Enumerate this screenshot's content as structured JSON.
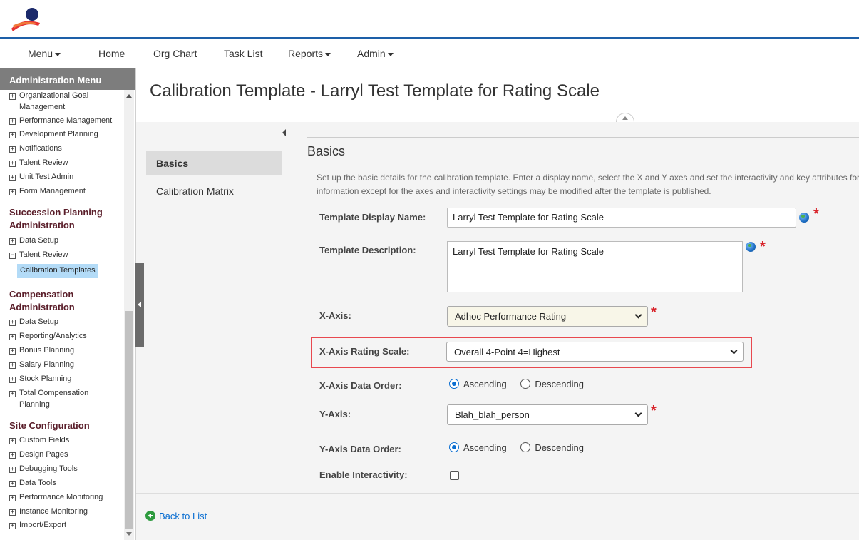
{
  "nav": {
    "menu": "Menu",
    "home": "Home",
    "org_chart": "Org Chart",
    "task_list": "Task List",
    "reports": "Reports",
    "admin": "Admin"
  },
  "sidebar": {
    "header": "Administration Menu",
    "items_top": [
      {
        "label": "Organizational Goal",
        "label2": "Management"
      },
      {
        "label": "Performance Management"
      },
      {
        "label": "Development Planning"
      },
      {
        "label": "Notifications"
      },
      {
        "label": "Talent Review"
      },
      {
        "label": "Unit Test Admin"
      },
      {
        "label": "Form Management"
      }
    ],
    "succession": {
      "title1": "Succession Planning",
      "title2": "Administration",
      "items": [
        "Data Setup",
        "Talent Review"
      ],
      "active": "Calibration Templates"
    },
    "compensation": {
      "title1": "Compensation",
      "title2": "Administration",
      "items": [
        "Data Setup",
        "Reporting/Analytics",
        "Bonus Planning",
        "Salary Planning",
        "Stock Planning"
      ],
      "total_comp1": "Total Compensation",
      "total_comp2": "Planning"
    },
    "site": {
      "title": "Site Configuration",
      "items": [
        "Custom Fields",
        "Design Pages",
        "Debugging Tools",
        "Data Tools",
        "Performance Monitoring",
        "Instance Monitoring",
        "Import/Export"
      ]
    }
  },
  "page": {
    "title": "Calibration Template - Larryl Test Template for Rating Scale"
  },
  "left_nav": {
    "basics": "Basics",
    "matrix": "Calibration Matrix"
  },
  "form": {
    "section_title": "Basics",
    "description_line1": "Set up the basic details for the calibration template. Enter a display name, select the X and Y axes and set the interactivity and key attributes for this",
    "description_line2": "information except for the axes and interactivity settings may be modified after the template is published.",
    "display_name_label": "Template Display Name:",
    "display_name_value": "Larryl Test Template for Rating Scale",
    "description_label": "Template Description:",
    "description_value": "Larryl Test Template for Rating Scale",
    "x_axis_label": "X-Axis:",
    "x_axis_value": "Adhoc Performance Rating",
    "x_rating_label": "X-Axis Rating Scale:",
    "x_rating_value": "Overall 4-Point 4=Highest",
    "x_order_label": "X-Axis Data Order:",
    "y_axis_label": "Y-Axis:",
    "y_axis_value": "Blah_blah_person",
    "y_order_label": "Y-Axis Data Order:",
    "ascending": "Ascending",
    "descending": "Descending",
    "interactivity_label": "Enable Interactivity:",
    "required_mark": "*"
  },
  "footer": {
    "back": "Back to List"
  },
  "colors": {
    "accent_blue": "#1d5fa8",
    "required_red": "#d8232a",
    "highlight_red": "#e8484f",
    "link_blue": "#0a6ed1"
  }
}
